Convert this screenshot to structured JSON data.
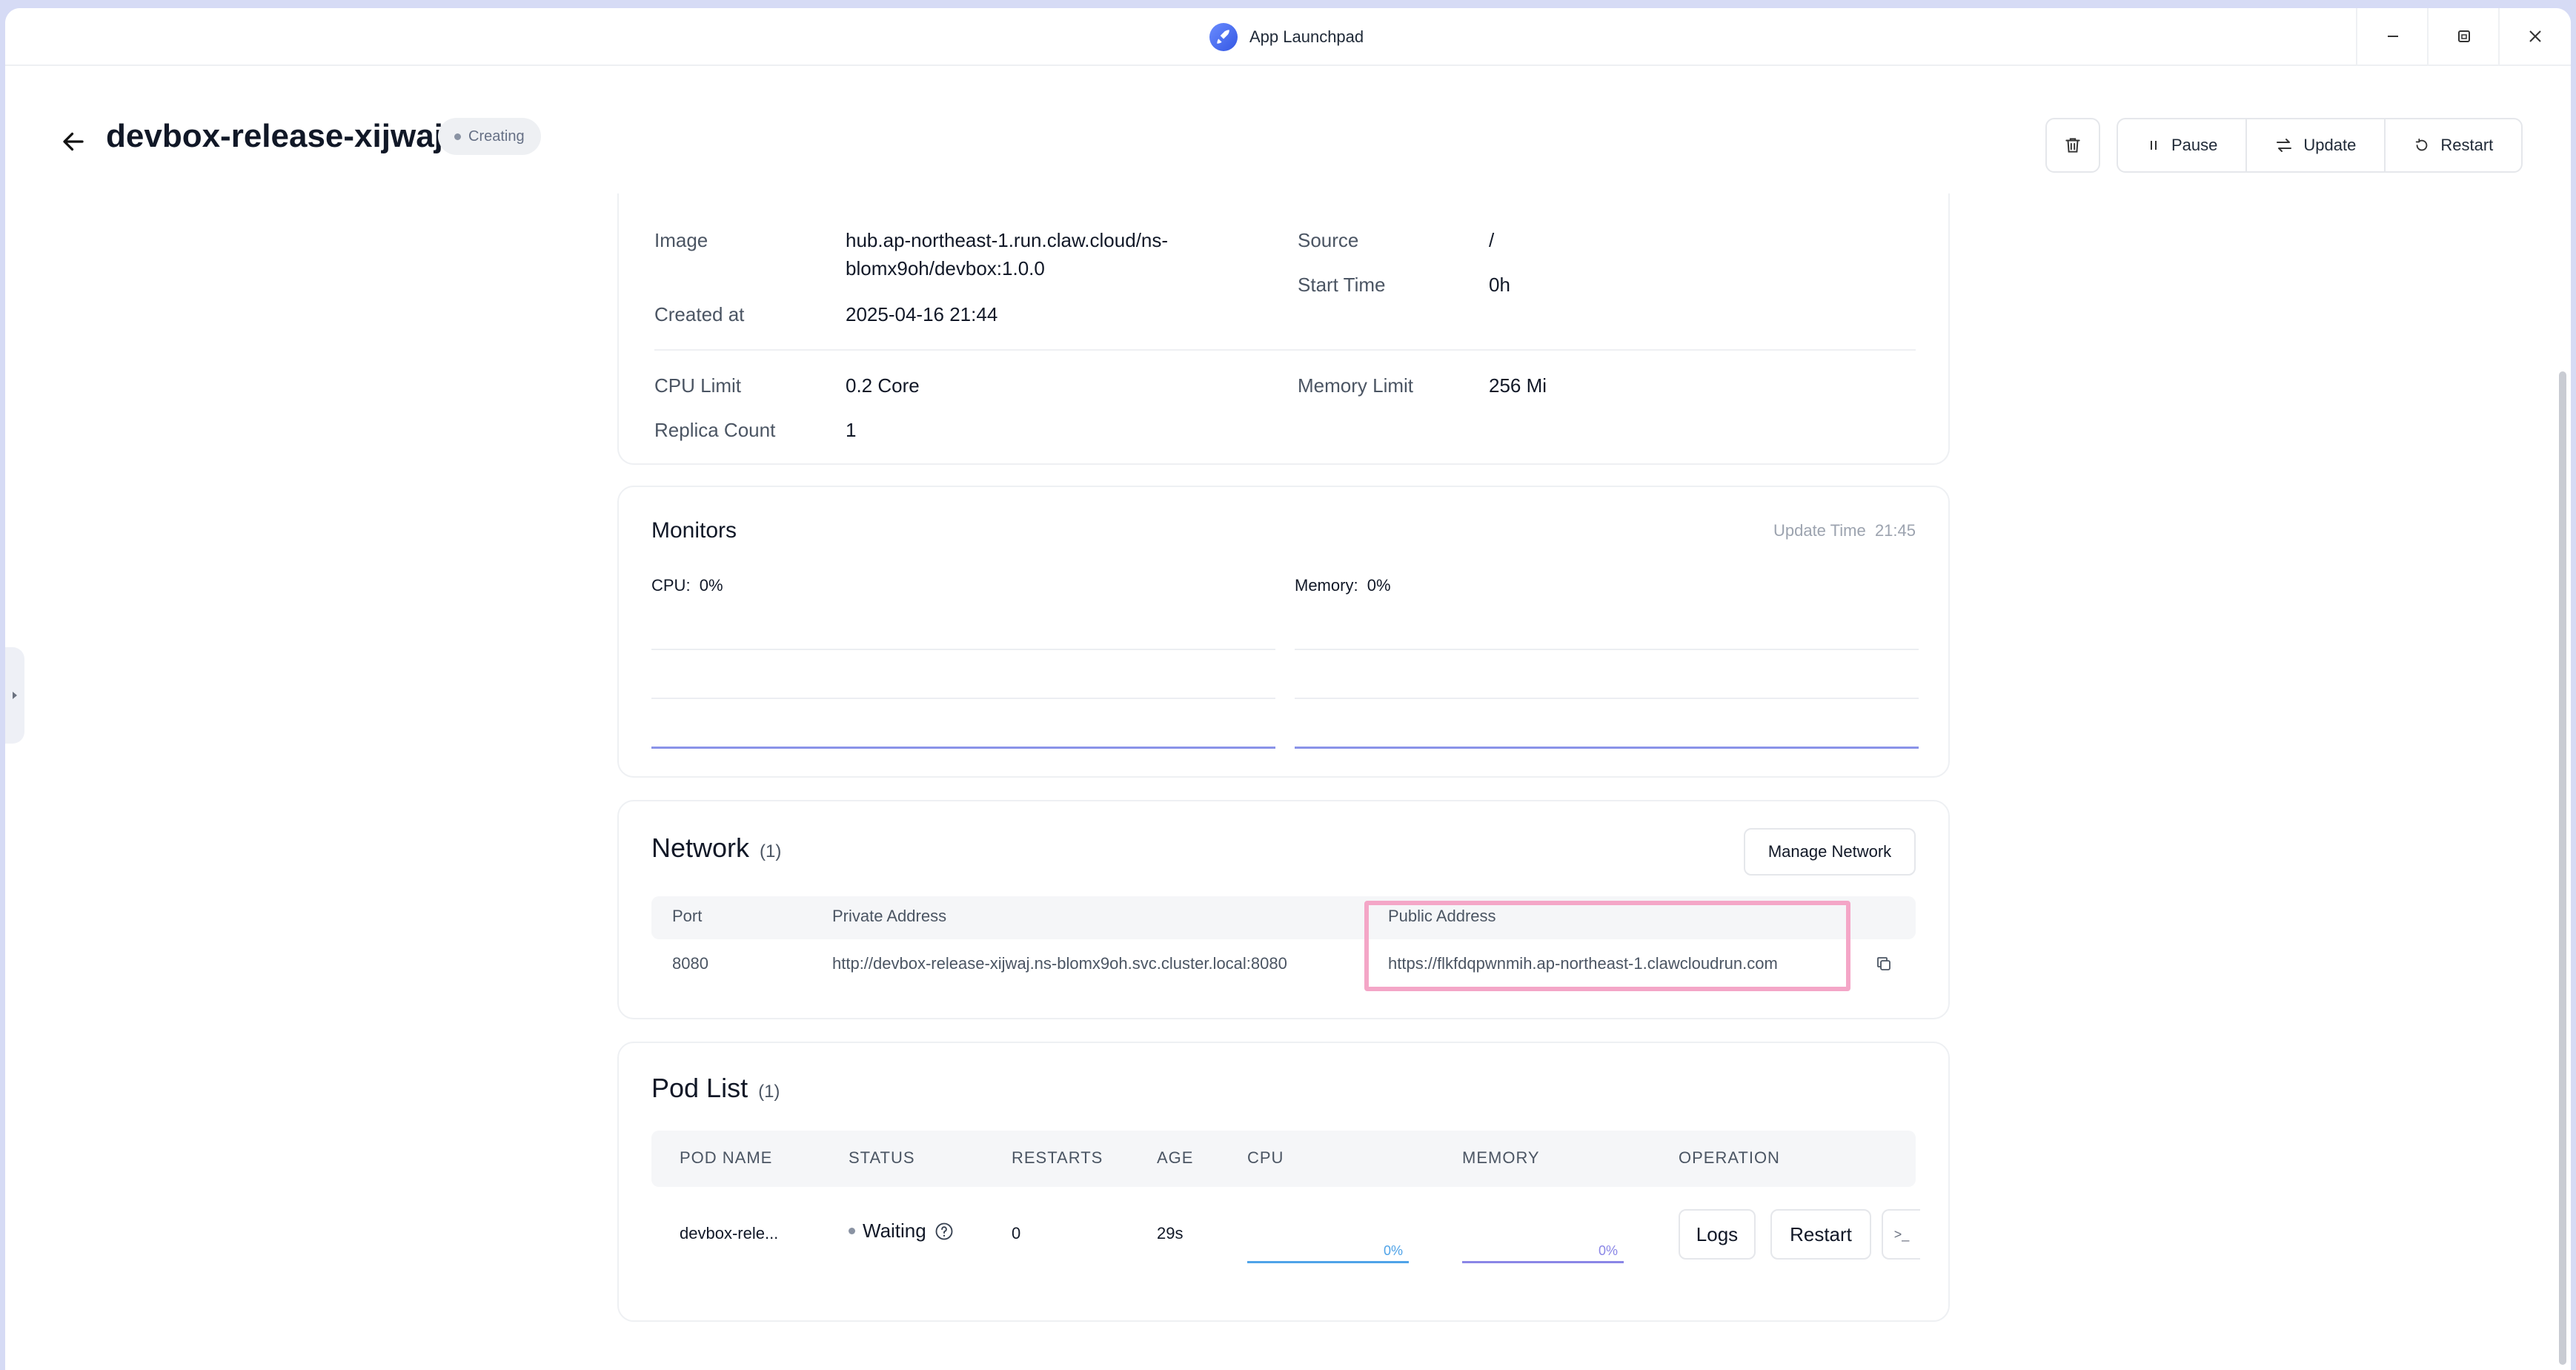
{
  "window": {
    "title": "App Launchpad"
  },
  "header": {
    "app_name": "devbox-release-xijwaj",
    "status": "Creating",
    "actions": {
      "pause": "Pause",
      "update": "Update",
      "restart": "Restart"
    }
  },
  "info": {
    "image_label": "Image",
    "image_value_line1": "hub.ap-northeast-1.run.claw.cloud/ns-",
    "image_value_line2": "blomx9oh/devbox:1.0.0",
    "created_label": "Created at",
    "created_value": "2025-04-16 21:44",
    "source_label": "Source",
    "source_value": "/",
    "start_label": "Start Time",
    "start_value": "0h",
    "cpu_label": "CPU Limit",
    "cpu_value": "0.2 Core",
    "memory_label": "Memory Limit",
    "memory_value": "256 Mi",
    "replica_label": "Replica Count",
    "replica_value": "1"
  },
  "monitors": {
    "title": "Monitors",
    "update_time_label": "Update Time",
    "update_time_value": "21:45",
    "cpu_label": "CPU:",
    "cpu_value": "0%",
    "memory_label": "Memory:",
    "memory_value": "0%"
  },
  "network": {
    "title": "Network",
    "count": "(1)",
    "manage_button": "Manage Network",
    "columns": {
      "port": "Port",
      "private": "Private Address",
      "public": "Public Address"
    },
    "row": {
      "port": "8080",
      "private": "http://devbox-release-xijwaj.ns-blomx9oh.svc.cluster.local:8080",
      "public": "https://flkfdqpwnmih.ap-northeast-1.clawcloudrun.com"
    }
  },
  "pods": {
    "title": "Pod List",
    "count": "(1)",
    "columns": {
      "name": "POD NAME",
      "status": "STATUS",
      "restarts": "RESTARTS",
      "age": "AGE",
      "cpu": "CPU",
      "memory": "MEMORY",
      "operation": "OPERATION"
    },
    "row": {
      "name": "devbox-rele...",
      "status": "Waiting",
      "restarts": "0",
      "age": "29s",
      "cpu_pct": "0%",
      "memory_pct": "0%",
      "logs_button": "Logs",
      "restart_button": "Restart",
      "terminal_button": ">_"
    }
  },
  "colors": {
    "cpu_bar": "#4fa3e8",
    "memory_bar": "#8a86e6",
    "highlight": "#f4a6c7",
    "accent": "#3457e3"
  }
}
